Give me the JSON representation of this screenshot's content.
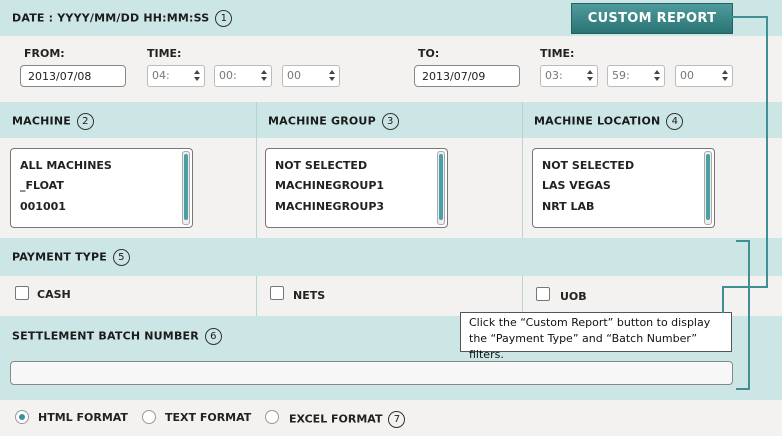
{
  "header": {
    "date_label": "DATE : YYYY/MM/DD HH:MM:SS",
    "num": "1",
    "custom_report_label": "CUSTOM REPORT"
  },
  "from": {
    "label": "FROM:",
    "date": "2013/07/08",
    "time_label": "TIME:",
    "hour": "04:",
    "minute": "00:",
    "second": "00"
  },
  "to": {
    "label": "TO:",
    "date": "2013/07/09",
    "time_label": "TIME:",
    "hour": "03:",
    "minute": "59:",
    "second": "00"
  },
  "machine": {
    "label": "MACHINE",
    "num": "2",
    "items": [
      "ALL MACHINES",
      "_FLOAT",
      "001001"
    ]
  },
  "machine_group": {
    "label": "MACHINE GROUP",
    "num": "3",
    "items": [
      "NOT SELECTED",
      "MACHINEGROUP1",
      "MACHINEGROUP3"
    ]
  },
  "machine_location": {
    "label": "MACHINE LOCATION",
    "num": "4",
    "items": [
      "NOT SELECTED",
      "LAS VEGAS",
      "NRT LAB"
    ]
  },
  "payment": {
    "label": "PAYMENT TYPE",
    "num": "5",
    "options": [
      "CASH",
      "NETS",
      "UOB"
    ]
  },
  "settlement": {
    "label": "SETTLEMENT BATCH NUMBER",
    "num": "6",
    "value": ""
  },
  "format": {
    "num": "7",
    "options": [
      "HTML FORMAT",
      "TEXT FORMAT",
      "EXCEL FORMAT"
    ],
    "selected": "HTML FORMAT"
  },
  "callout": {
    "text": "Click the “Custom Report” button to display the “Payment Type” and “Batch Number” filters."
  },
  "colors": {
    "band": "#cce6e6",
    "accent": "#2b7476",
    "connector": "#3f8f95"
  }
}
